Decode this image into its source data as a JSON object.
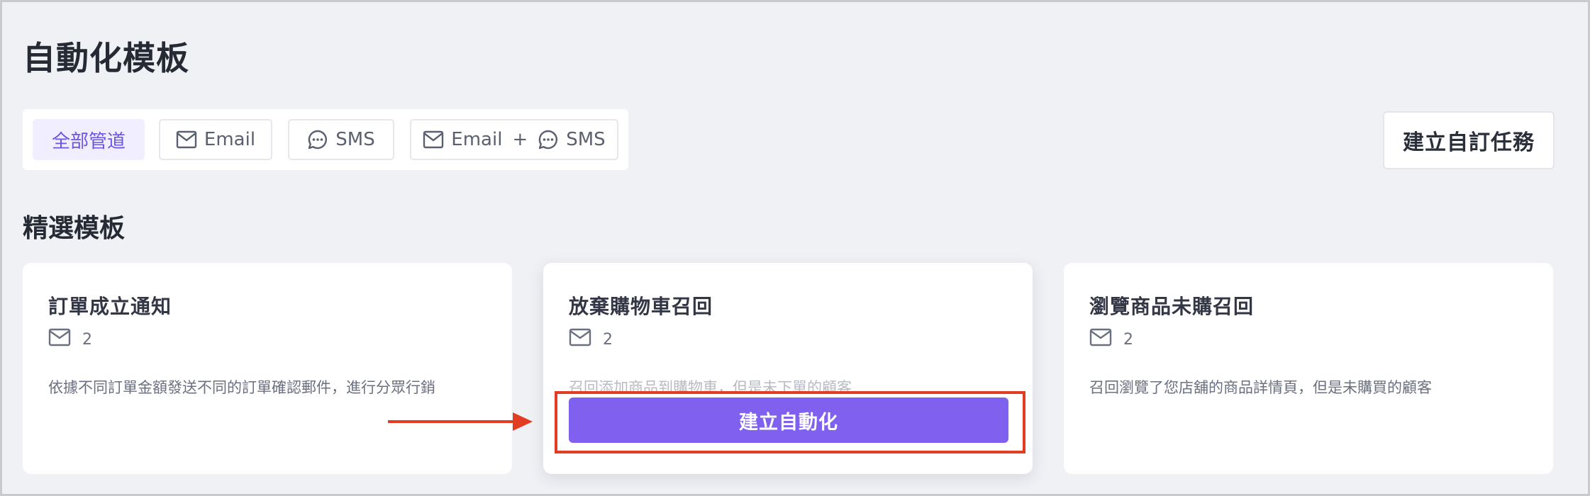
{
  "page": {
    "title": "自動化模板"
  },
  "filters": {
    "all_label": "全部管道",
    "email_label": "Email",
    "sms_label": "SMS",
    "combo_email_label": "Email",
    "combo_plus": "+",
    "combo_sms_label": "SMS",
    "active": "全部管道"
  },
  "actions": {
    "custom_task_label": "建立自訂任務"
  },
  "featured": {
    "section_title": "精選模板",
    "cards": [
      {
        "title": "訂單成立通知",
        "channel_icon": "mail-icon",
        "email_count": "2",
        "description": "依據不同訂單金額發送不同的訂單確認郵件，進行分眾行銷"
      },
      {
        "title": "放棄購物車召回",
        "channel_icon": "mail-icon",
        "email_count": "2",
        "description": "召回添加商品到購物車，但是未下單的顧客",
        "button_label": "建立自動化"
      },
      {
        "title": "瀏覽商品未購召回",
        "channel_icon": "mail-icon",
        "email_count": "2",
        "description": "召回瀏覽了您店舖的商品詳情頁，但是未購買的顧客"
      }
    ]
  },
  "colors": {
    "accent": "#8060ee",
    "active_chip_bg": "#f1efff",
    "active_chip_text": "#6a55e6",
    "annotation": "#e23d22",
    "page_bg": "#f0f1f5"
  }
}
